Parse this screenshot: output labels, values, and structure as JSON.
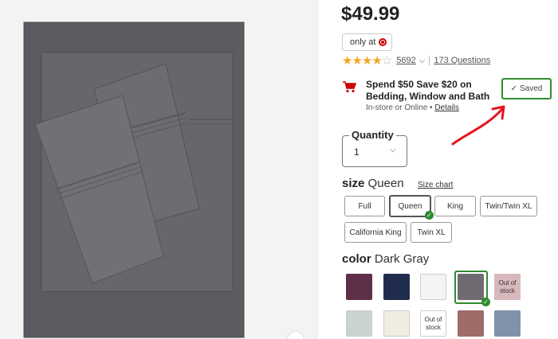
{
  "product": {
    "price": "$49.99",
    "only_at": "only at",
    "rating_stars": 4,
    "review_count": "5692",
    "questions": "173 Questions"
  },
  "promo": {
    "title": "Spend $50 Save $20 on Bedding, Window and Bath",
    "availability": "In-store or Online •",
    "details_link": "Details",
    "saved_label": "Saved"
  },
  "quantity": {
    "label": "Quantity",
    "value": "1"
  },
  "size": {
    "heading": "size",
    "selected": "Queen",
    "size_chart": "Size chart",
    "options": [
      "Full",
      "Queen",
      "King",
      "Twin/Twin XL",
      "California King",
      "Twin XL"
    ]
  },
  "color": {
    "heading": "color",
    "selected": "Dark Gray",
    "out_of_stock": "Out of stock",
    "swatches": [
      {
        "name": "plum",
        "hex": "#5e2f48"
      },
      {
        "name": "navy",
        "hex": "#1f2c4d"
      },
      {
        "name": "white",
        "hex": "#f4f4f4"
      },
      {
        "name": "dark-gray",
        "hex": "#6f6b70"
      },
      {
        "name": "mauve-out-of-stock",
        "hex": "#c9a2a8"
      },
      {
        "name": "light-blue-gray",
        "hex": "#c8d3d2"
      },
      {
        "name": "cream",
        "hex": "#efece2"
      },
      {
        "name": "ivory-out-of-stock",
        "hex": "#ffffff"
      },
      {
        "name": "rose-brown",
        "hex": "#a06c6a"
      },
      {
        "name": "slate-blue",
        "hex": "#8092a8"
      }
    ]
  },
  "colors": {
    "accent_green": "#2e8b2e",
    "annotation_red": "#e8141e",
    "target_red": "#cc0000",
    "star_gold": "#f5a623"
  }
}
